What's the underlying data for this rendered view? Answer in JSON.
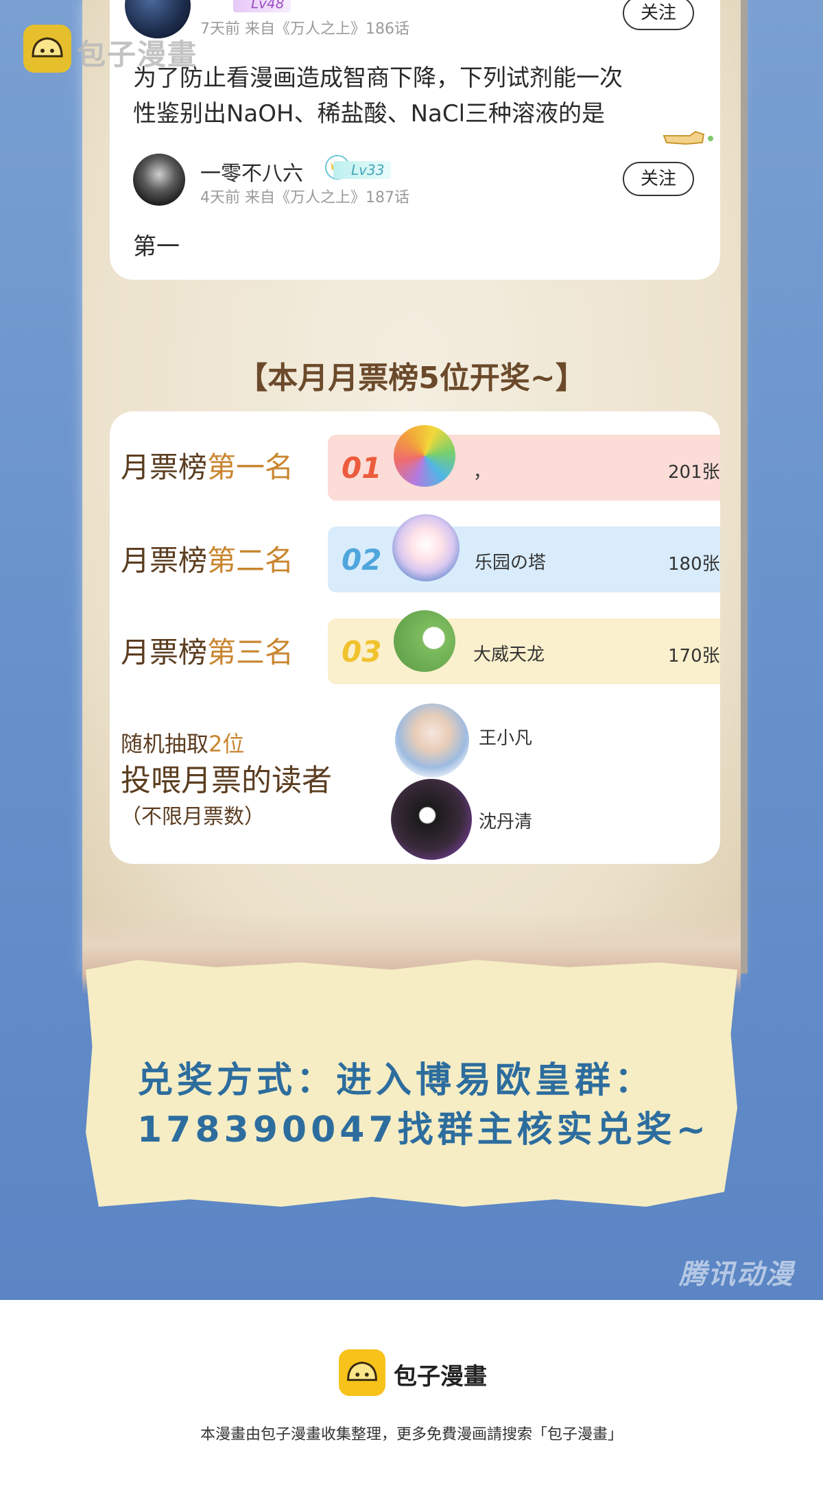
{
  "brand": {
    "name": "包子漫畫",
    "watermark": "腾讯动漫",
    "footer_title": "包子漫畫",
    "footer_note": "本漫畫由包子漫畫收集整理，更多免費漫画請搜索「包子漫畫」"
  },
  "comments": [
    {
      "level": "Lv48",
      "meta": "7天前  来自《万人之上》186话",
      "follow_label": "关注",
      "text_lines": [
        "为了防止看漫画造成智商下降，下列试剂能一次",
        "性鉴别出NaOH、稀盐酸、NaCl三种溶液的是"
      ]
    },
    {
      "username": "一零不八六",
      "level": "Lv33",
      "meta": "4天前  来自《万人之上》187话",
      "follow_label": "关注",
      "text": "第一"
    }
  ],
  "section_title": "【本月月票榜5位开奖~】",
  "rankings": [
    {
      "prefix": "月票榜",
      "highlight": "第一名",
      "num": "01",
      "name": "，",
      "votes": "201张",
      "bar_color": "#fbdcd6",
      "num_color": "#ec5b3c"
    },
    {
      "prefix": "月票榜",
      "highlight": "第二名",
      "num": "02",
      "name": "乐园の塔",
      "votes": "180张",
      "bar_color": "#d9ecfb",
      "num_color": "#4fa6dc"
    },
    {
      "prefix": "月票榜",
      "highlight": "第三名",
      "num": "03",
      "name": "大威天龙",
      "votes": "170张",
      "bar_color": "#fbf0cd",
      "num_color": "#efc22e"
    }
  ],
  "random_draw": {
    "line1_prefix": "随机抽取",
    "line1_highlight": "2位",
    "line2": "投喂月票的读者",
    "line3": "（不限月票数）",
    "winners": [
      "王小凡",
      "沈丹清"
    ]
  },
  "redeem": {
    "line1": "兑奖方式：进入博易欧皇群：",
    "line2": "178390047找群主核实兑奖~"
  }
}
